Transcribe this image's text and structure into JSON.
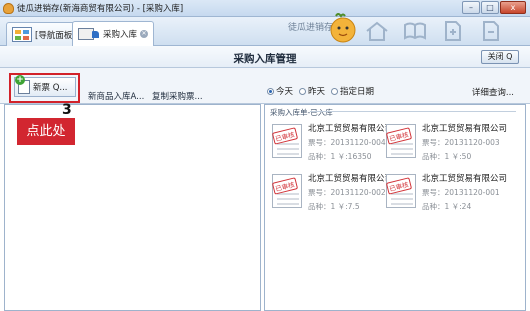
{
  "window": {
    "title": "徒瓜进销存(新海商贸有限公司) - [采购入库]",
    "controls": [
      "–",
      "□",
      "x"
    ]
  },
  "tabs": [
    {
      "label": "[导航面板]",
      "icon": "grid-icon",
      "active": false,
      "closable": false
    },
    {
      "label": "采购入库",
      "icon": "truck-icon",
      "active": true,
      "closable": true
    }
  ],
  "brand": {
    "text": "徒瓜进销存"
  },
  "page": {
    "title": "采购入库管理",
    "close_label": "关闭 Q"
  },
  "toolbar": {
    "new_label": "新票 Q...",
    "links": [
      "新商品入库A...",
      "复制采购票..."
    ],
    "date_filter": {
      "options": [
        "今天",
        "昨天",
        "指定日期"
      ],
      "selected": "今天"
    },
    "detail_link": "详细查询..."
  },
  "annotation": {
    "step": "3",
    "callout": "点此处",
    "color": "#d2222a"
  },
  "list": {
    "group_label": "采购入库单-已入库",
    "cards": [
      {
        "company": "北京工贸贸易有限公司",
        "ticket": "票号：20131120-004",
        "summary": "品种：1 ￥:16350",
        "stamp": "已审核"
      },
      {
        "company": "北京工贸贸易有限公司",
        "ticket": "票号：20131120-003",
        "summary": "品种：1 ￥:50",
        "stamp": "已审核"
      },
      {
        "company": "北京工贸贸易有限公司",
        "ticket": "票号：20131120-002",
        "summary": "品种：1 ￥:7.5",
        "stamp": "已审核"
      },
      {
        "company": "北京工贸贸易有限公司",
        "ticket": "票号：20131120-001",
        "summary": "品种：1 ￥:24",
        "stamp": "已审核"
      }
    ]
  }
}
